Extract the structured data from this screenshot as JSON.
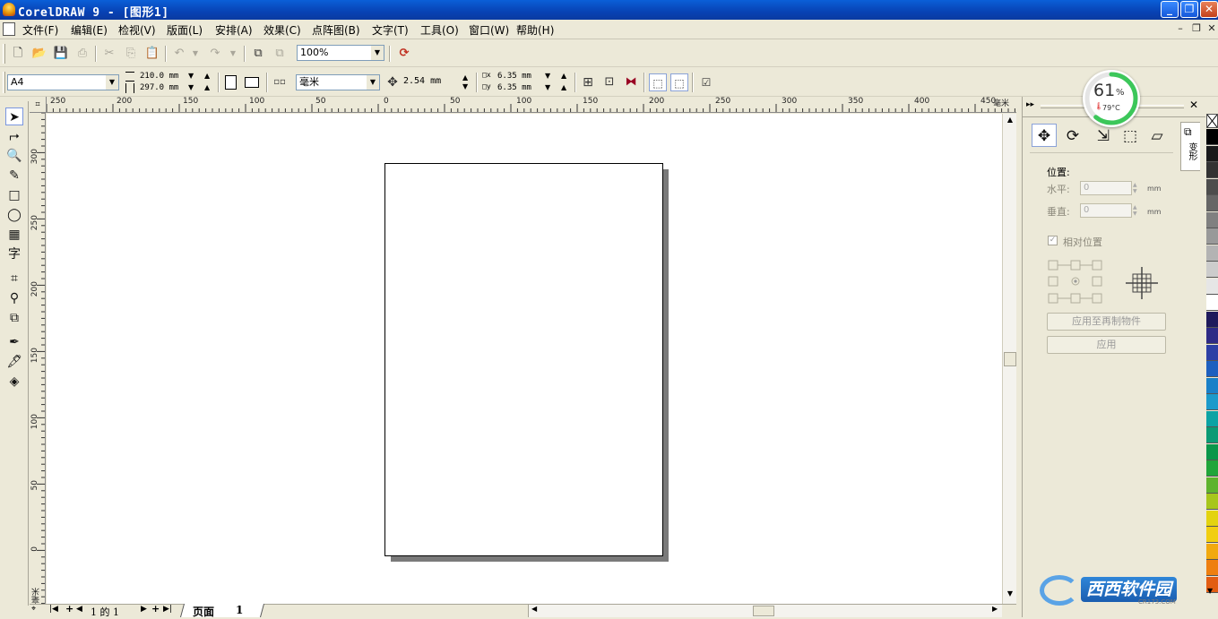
{
  "window": {
    "title": "CorelDRAW 9 - [图形1]",
    "controls": {
      "minimize": "_",
      "restore": "❐",
      "close": "✕"
    }
  },
  "menu": {
    "items": [
      "文件(F)",
      "编辑(E)",
      "检视(V)",
      "版面(L)",
      "安排(A)",
      "效果(C)",
      "点阵图(B)",
      "文字(T)",
      "工具(O)",
      "窗口(W)",
      "帮助(H)"
    ],
    "doc_controls": {
      "minimize": "–",
      "restore": "❐",
      "close": "✕"
    }
  },
  "standard_toolbar": {
    "zoom_value": "100%"
  },
  "property_bar": {
    "paper_size": "A4",
    "width": "210.0 mm",
    "height": "297.0 mm",
    "units": "毫米",
    "nudge": "2.54 mm",
    "dup_x": "6.35 mm",
    "dup_y": "6.35 mm"
  },
  "rulers": {
    "horizontal_labels": [
      "250",
      "200",
      "150",
      "100",
      "50",
      "0",
      "50",
      "100",
      "150",
      "200",
      "250",
      "300",
      "350",
      "400",
      "450",
      "毫米"
    ],
    "vertical_labels": [
      "300",
      "250",
      "200",
      "150",
      "100",
      "50",
      "0",
      "毫米"
    ]
  },
  "page_nav": {
    "position": "1 的 1",
    "tab_label": "页面",
    "tab_number": "1"
  },
  "gauge": {
    "value": "61",
    "unit": "%",
    "temp": "79°C",
    "fraction": 0.61,
    "color": "#3cc75a"
  },
  "docker": {
    "tab_label": "变形",
    "section_title": "位置:",
    "h_label": "水平:",
    "h_value": "0",
    "v_label": "垂直:",
    "v_value": "0",
    "unit": "mm",
    "relative_label": "相对位置",
    "apply_copy": "应用至再制物件",
    "apply": "应用"
  },
  "palette_colors": [
    "#000000",
    "#1a1a1a",
    "#333333",
    "#4d4d4d",
    "#666666",
    "#808080",
    "#999999",
    "#b3b3b3",
    "#cccccc",
    "#e6e6e6",
    "#ffffff",
    "#1f1a5c",
    "#2e2a86",
    "#2d3fa5",
    "#1d5fbf",
    "#1a80c8",
    "#1c9acb",
    "#0ba3a4",
    "#0b9a74",
    "#0a964a",
    "#21a53a",
    "#5fb32d",
    "#a7c61c",
    "#e3d30f",
    "#f1ce10",
    "#f1a90f",
    "#ee7f10",
    "#e25d13"
  ],
  "watermark": {
    "text": "西西软件园",
    "sub": "CR173.COM"
  }
}
